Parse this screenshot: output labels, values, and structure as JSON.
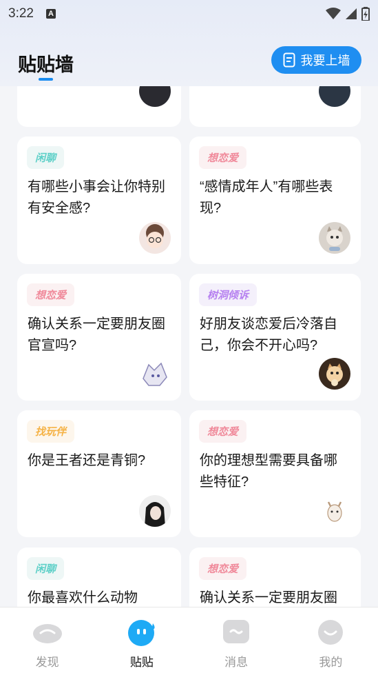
{
  "status_bar": {
    "time": "3:22",
    "indicator": "A"
  },
  "header": {
    "title": "贴贴墙",
    "post_button_label": "我要上墙",
    "post_icon": "note-icon"
  },
  "cards": [
    {
      "tag": "闲聊",
      "tag_kind": "chat",
      "text": "有哪些小事会让你特别有安全感?",
      "avatar": "boy-glasses-avatar"
    },
    {
      "tag": "想恋爱",
      "tag_kind": "love",
      "text": "“感情成年人”有哪些表现?",
      "avatar": "cat-avatar"
    },
    {
      "tag": "想恋爱",
      "tag_kind": "love",
      "text": "确认关系一定要朋友圈官宣吗?",
      "avatar": "anime-avatar"
    },
    {
      "tag": "树洞倾诉",
      "tag_kind": "tree",
      "text": "好朋友谈恋爱后冷落自己，你会不开心吗?",
      "avatar": "kitten-avatar"
    },
    {
      "tag": "找玩伴",
      "tag_kind": "play",
      "text": "你是王者还是青铜?",
      "avatar": "girl-avatar"
    },
    {
      "tag": "想恋爱",
      "tag_kind": "love",
      "text": "你的理想型需要具备哪些特征?",
      "avatar": "goat-avatar"
    },
    {
      "tag": "闲聊",
      "tag_kind": "chat",
      "text": "你最喜欢什么动物",
      "avatar": "none"
    },
    {
      "tag": "想恋爱",
      "tag_kind": "love",
      "text": "确认关系一定要朋友圈",
      "avatar": "none"
    }
  ],
  "nav": [
    {
      "label": "发现",
      "icon": "discover-icon",
      "active": false
    },
    {
      "label": "贴贴",
      "icon": "tietie-icon",
      "active": true
    },
    {
      "label": "消息",
      "icon": "message-icon",
      "active": false
    },
    {
      "label": "我的",
      "icon": "profile-icon",
      "active": false
    }
  ]
}
